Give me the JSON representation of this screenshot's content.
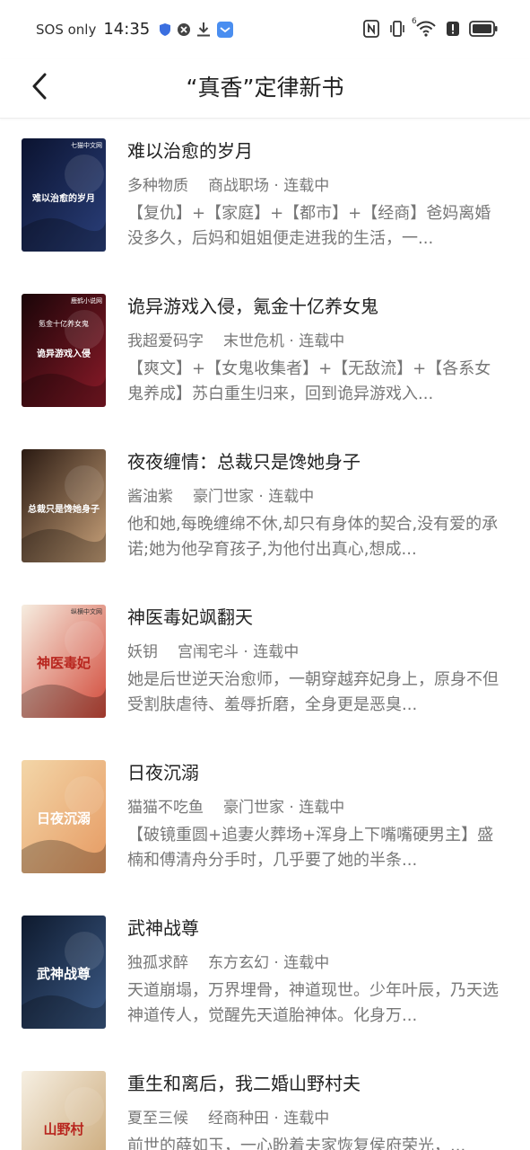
{
  "status_bar": {
    "carrier": "SOS only",
    "time": "14:35",
    "icons_left": [
      "shield-icon",
      "blocked-icon",
      "download-icon",
      "app-notification-icon"
    ],
    "icons_right": [
      "nfc-icon",
      "vibrate-icon",
      "wifi-icon",
      "alert-icon",
      "battery-icon"
    ],
    "wifi_label": "6"
  },
  "header": {
    "back_icon": "chevron-left-icon",
    "title": "“真香”定律新书"
  },
  "books": [
    {
      "title": "难以治愈的岁月",
      "author": "多种物质",
      "genre": "商战职场",
      "status": "连载中",
      "description": "【复仇】+【家庭】+【都市】+【经商】爸妈离婚没多久，后妈和姐姐便走进我的生活，一...",
      "cover_text": "难以治愈的岁月",
      "cover_badge": "七猫中文网",
      "cover_colors": [
        "#0b1330",
        "#2a3f7a"
      ]
    },
    {
      "title": "诡异游戏入侵，氪金十亿养女鬼",
      "author": "我超爱码字",
      "genre": "末世危机",
      "status": "连载中",
      "description": "【爽文】+【女鬼收集者】+【无敌流】+【各系女鬼养成】苏白重生归来，回到诡异游戏入...",
      "cover_text": "诡异游戏入侵",
      "cover_subtext": "氪金十亿养女鬼",
      "cover_badge": "鹿鹤小说网",
      "cover_colors": [
        "#1a0508",
        "#8a1a28"
      ]
    },
    {
      "title": "夜夜缠情：总裁只是馋她身子",
      "author": "酱油紫",
      "genre": "豪门世家",
      "status": "连载中",
      "description": "他和她,每晚缠绵不休,却只有身体的契合,没有爱的承诺;她为他孕育孩子,为他付出真心,想成...",
      "cover_text": "总裁只是馋她身子",
      "cover_colors": [
        "#2a1a12",
        "#c9a27a"
      ]
    },
    {
      "title": "神医毒妃飒翻天",
      "author": "妖钥",
      "genre": "宫闱宅斗",
      "status": "连载中",
      "description": "她是后世逆天治愈师，一朝穿越弃妃身上，原身不但受割肤虐待、羞辱折磨，全身更是恶臭...",
      "cover_text": "神医毒妃",
      "cover_badge": "纵横中文网",
      "cover_colors": [
        "#f6ede0",
        "#d24a3a"
      ]
    },
    {
      "title": "日夜沉溺",
      "author": "猫猫不吃鱼",
      "genre": "豪门世家",
      "status": "连载中",
      "description": "【破镜重圆+追妻火葬场+浑身上下嘴嘴硬男主】盛楠和傅清舟分手时，几乎要了她的半条...",
      "cover_text": "日夜沉溺",
      "cover_colors": [
        "#f3d6a8",
        "#e69a62"
      ]
    },
    {
      "title": "武神战尊",
      "author": "独孤求醉",
      "genre": "东方玄幻",
      "status": "连载中",
      "description": "天道崩塌，万界埋骨，神道现世。少年叶辰，乃天选神道传人，觉醒先天道胎神体。化身万...",
      "cover_text": "武神战尊",
      "cover_colors": [
        "#0e1a2e",
        "#3c5a86"
      ]
    },
    {
      "title": "重生和离后，我二婚山野村夫",
      "author": "夏至三候",
      "genre": "经商种田",
      "status": "连载中",
      "description": "前世的薛如玉，一心盼着夫家恢复侯府荣光，...",
      "cover_text": "山野村",
      "cover_colors": [
        "#f6efe2",
        "#c8a472"
      ]
    }
  ]
}
